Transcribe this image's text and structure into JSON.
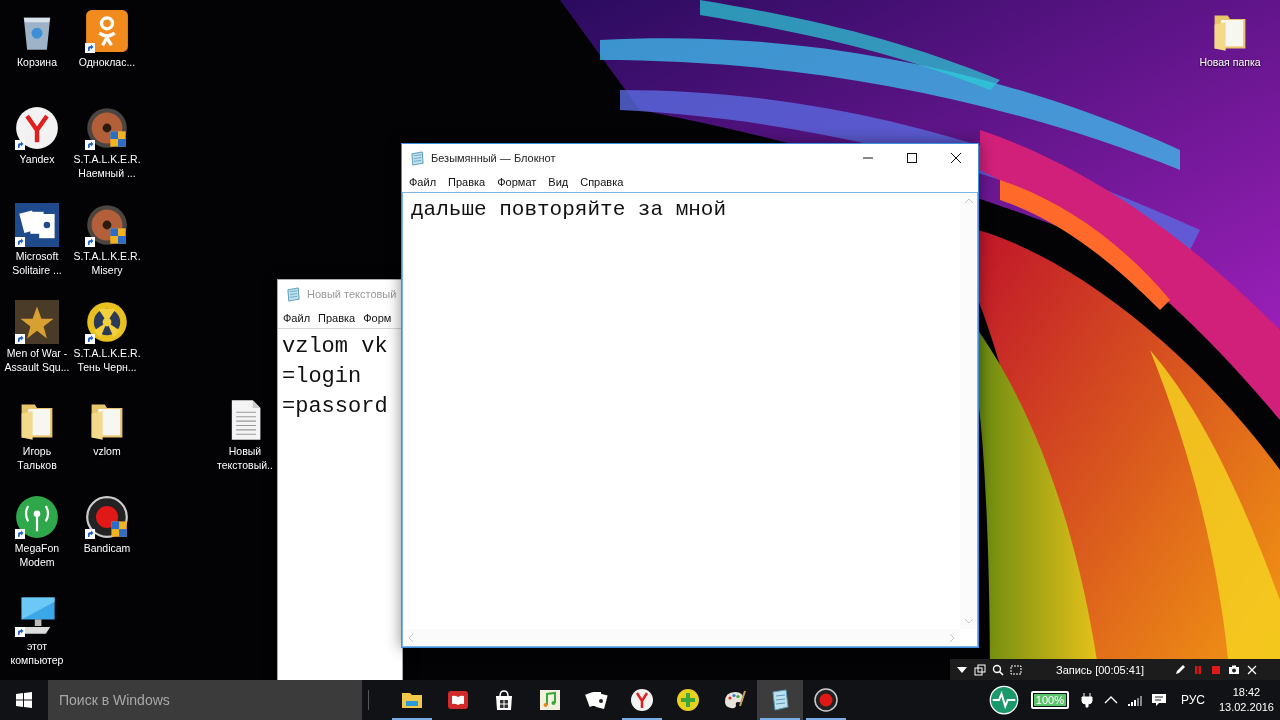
{
  "desktop": {
    "icons": [
      {
        "kind": "recycle-bin",
        "label": "Корзина",
        "shortcut": false
      },
      {
        "kind": "ok",
        "label": "Одноклас...",
        "shortcut": true
      },
      {
        "kind": "yandex",
        "label": "Yandex",
        "shortcut": true
      },
      {
        "kind": "stalker",
        "label": "S.T.A.L.K.E.R. Наемный ...",
        "shortcut": true
      },
      {
        "kind": "solitaire",
        "label": "Microsoft Solitaire ...",
        "shortcut": true
      },
      {
        "kind": "stalker",
        "label": "S.T.A.L.K.E.R. Misery",
        "shortcut": true
      },
      {
        "kind": "medal",
        "label": "Men of War - Assault Squ...",
        "shortcut": true
      },
      {
        "kind": "radiation",
        "label": "S.T.A.L.K.E.R. Тень Черн...",
        "shortcut": true
      },
      {
        "kind": "folder",
        "label": "Игорь Тальков",
        "shortcut": false
      },
      {
        "kind": "folder",
        "label": "vzlom",
        "shortcut": false
      },
      {
        "kind": "megafon",
        "label": "MegaFon Modem",
        "shortcut": true
      },
      {
        "kind": "bandicam",
        "label": "Bandicam",
        "shortcut": true
      },
      {
        "kind": "computer",
        "label": "этот компьютер",
        "shortcut": true
      },
      {
        "kind": "text-file",
        "label": "Новый текстовый..",
        "shortcut": false
      },
      {
        "kind": "folder",
        "label": "Новая папка",
        "shortcut": false
      }
    ]
  },
  "windows": [
    {
      "title": "Новый текстовый",
      "active": false,
      "controls": false,
      "menu": [
        "Файл",
        "Правка",
        "Форм"
      ],
      "lines": [
        "vzlom vk",
        "=login",
        "=passord"
      ]
    },
    {
      "title": "Безымянный — Блокнот",
      "active": true,
      "controls": true,
      "menu": [
        "Файл",
        "Правка",
        "Формат",
        "Вид",
        "Справка"
      ],
      "lines": [
        "дальше повторяйте за мной"
      ]
    }
  ],
  "recorder": {
    "status": "Запись [00:05:41]"
  },
  "taskbar": {
    "search": {
      "placeholder": "Поиск в Windows"
    },
    "apps": [
      {
        "kind": "explorer",
        "running": true,
        "active": false
      },
      {
        "kind": "reader",
        "running": false,
        "active": false
      },
      {
        "kind": "store",
        "running": false,
        "active": false
      },
      {
        "kind": "music",
        "running": false,
        "active": false
      },
      {
        "kind": "solitaire",
        "running": false,
        "active": false
      },
      {
        "kind": "yandex",
        "running": true,
        "active": false
      },
      {
        "kind": "plus",
        "running": false,
        "active": false
      },
      {
        "kind": "paint",
        "running": false,
        "active": false
      },
      {
        "kind": "notepad",
        "running": true,
        "active": true
      },
      {
        "kind": "bandicam",
        "running": true,
        "active": false
      }
    ],
    "tray": {
      "battery": "100%",
      "language": "РУС",
      "time": "18:42",
      "date": "13.02.2016"
    }
  }
}
